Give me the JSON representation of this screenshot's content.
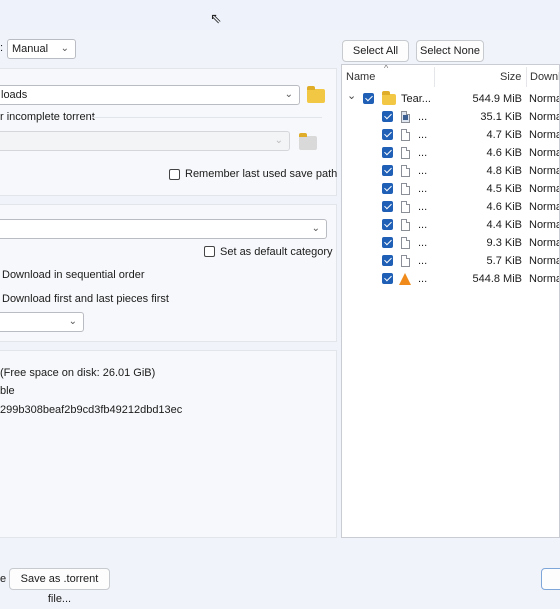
{
  "top": {
    "layout_label_fragment": ":",
    "layout_value": "Manual"
  },
  "save": {
    "path_value": "loads",
    "incomplete_label": "r incomplete torrent",
    "remember_label": "Remember last used save path"
  },
  "category": {
    "default_label": "Set as default category"
  },
  "options": {
    "sequential_label": "Download in sequential order",
    "first_last_label": "Download first and last pieces first"
  },
  "info": {
    "free_space": "(Free space on disk: 26.01 GiB)",
    "line2": "ble",
    "hash": "299b308beaf2b9cd3fb49212dbd13ec"
  },
  "bottom": {
    "left_fragment": "e",
    "save_torrent_label": "Save as .torrent file..."
  },
  "tree": {
    "select_all": "Select All",
    "select_none": "Select None",
    "sort_glyph": "^",
    "headers": {
      "name": "Name",
      "size": "Size",
      "priority": "Downl"
    },
    "root": {
      "name": "Tear...",
      "size": "544.9 MiB",
      "priority": "Norma",
      "expander": "⌄"
    },
    "files": [
      {
        "name": "...",
        "size": "35.1 KiB",
        "priority": "Norma",
        "icon": "image-file-icon"
      },
      {
        "name": "...",
        "size": "4.7 KiB",
        "priority": "Norma",
        "icon": "file-icon"
      },
      {
        "name": "...",
        "size": "4.6 KiB",
        "priority": "Norma",
        "icon": "file-icon"
      },
      {
        "name": "...",
        "size": "4.8 KiB",
        "priority": "Norma",
        "icon": "file-icon"
      },
      {
        "name": "...",
        "size": "4.5 KiB",
        "priority": "Norma",
        "icon": "file-icon"
      },
      {
        "name": "...",
        "size": "4.6 KiB",
        "priority": "Norma",
        "icon": "file-icon"
      },
      {
        "name": "...",
        "size": "4.4 KiB",
        "priority": "Norma",
        "icon": "file-icon"
      },
      {
        "name": "...",
        "size": "9.3 KiB",
        "priority": "Norma",
        "icon": "file-icon"
      },
      {
        "name": "...",
        "size": "5.7 KiB",
        "priority": "Norma",
        "icon": "file-icon"
      },
      {
        "name": "...",
        "size": "544.8 MiB",
        "priority": "Norma",
        "icon": "vlc-cone-icon"
      }
    ]
  },
  "glyphs": {
    "chevron": "⌄",
    "cursor": "⇖"
  },
  "colors": {
    "accent": "#1f5fb5",
    "folder": "#f2c744",
    "vlc": "#f08a1a"
  }
}
